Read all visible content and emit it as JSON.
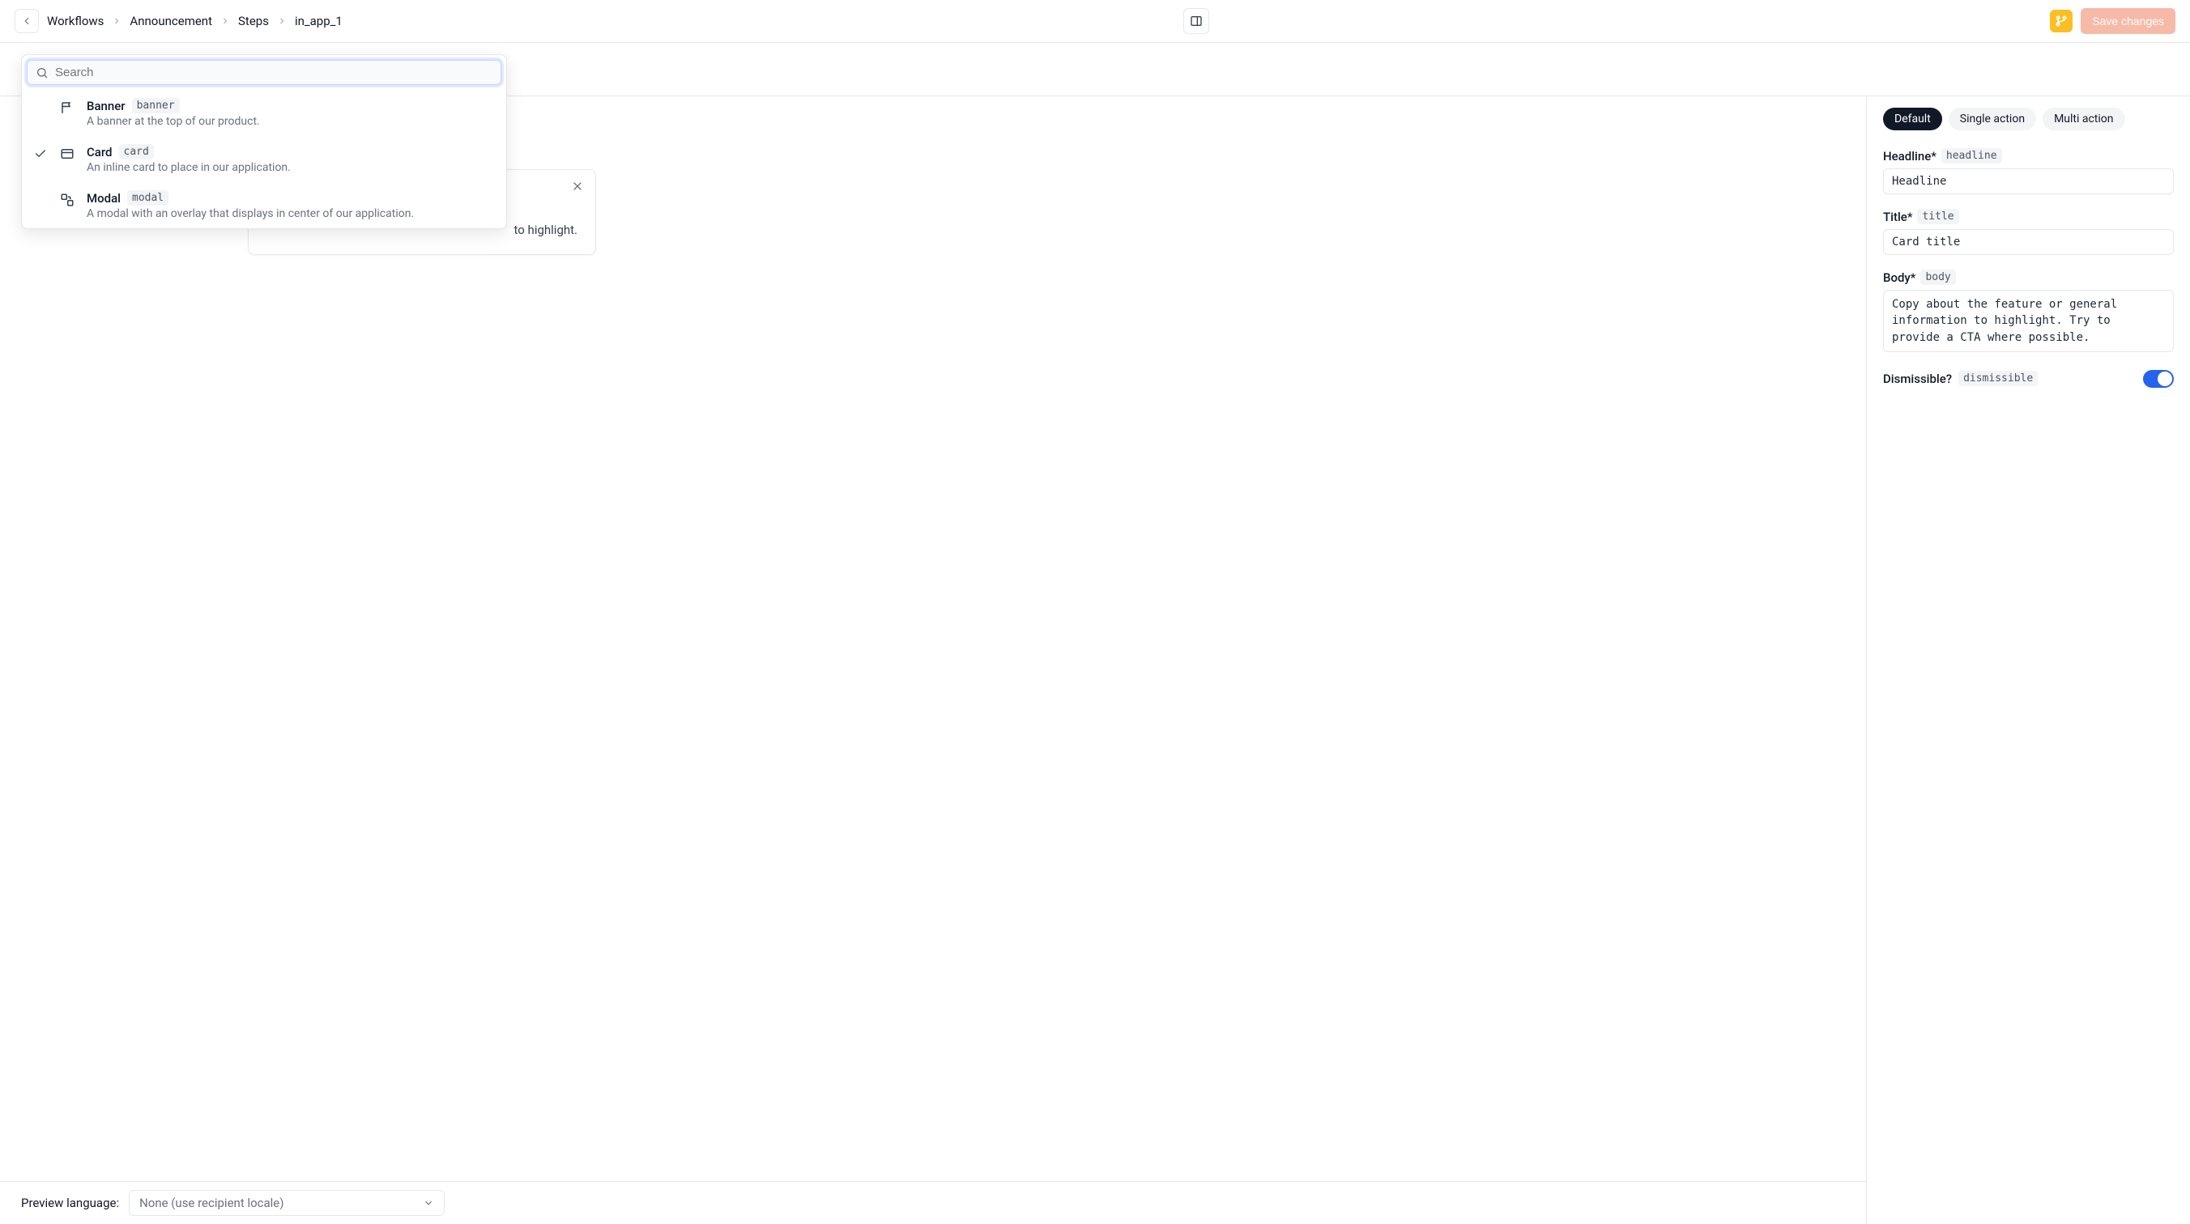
{
  "header": {
    "breadcrumbs": [
      "Workflows",
      "Announcement",
      "Steps",
      "in_app_1"
    ],
    "save_label": "Save changes"
  },
  "selector": {
    "current_label": "Card",
    "current_code": "card",
    "search_placeholder": "Search",
    "options": [
      {
        "title": "Banner",
        "code": "banner",
        "desc": "A banner at the top of our product.",
        "selected": false
      },
      {
        "title": "Card",
        "code": "card",
        "desc": "An inline card to place in our application.",
        "selected": true
      },
      {
        "title": "Modal",
        "code": "modal",
        "desc": "A modal with an overlay that displays in center of our application.",
        "selected": false
      }
    ]
  },
  "preview": {
    "visible_body_fragment": "to highlight."
  },
  "panel": {
    "tabs": [
      "Default",
      "Single action",
      "Multi action"
    ],
    "active_tab": 0,
    "headline": {
      "label": "Headline*",
      "code": "headline",
      "value": "Headline"
    },
    "title": {
      "label": "Title*",
      "code": "title",
      "value": "Card title"
    },
    "body": {
      "label": "Body*",
      "code": "body",
      "value": "Copy about the feature or general information to highlight. Try to provide a CTA where possible."
    },
    "dismissible": {
      "label": "Dismissible?",
      "code": "dismissible",
      "on": true
    }
  },
  "footer": {
    "label": "Preview language:",
    "select_value": "None (use recipient locale)"
  }
}
